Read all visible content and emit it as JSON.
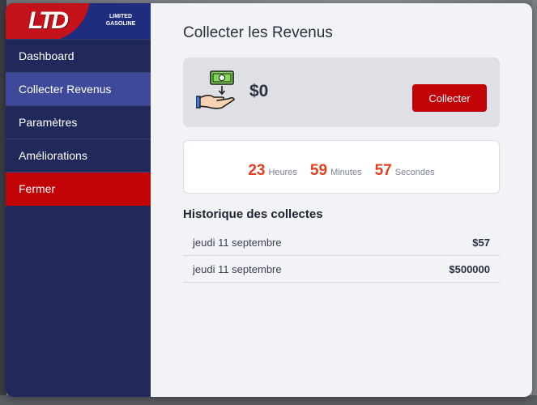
{
  "brand": {
    "logo_text": "LTD",
    "subtitle_line1": "LIMITED",
    "subtitle_line2": "GASOLINE",
    "accent_color": "#c10207",
    "sidebar_color": "#21295a"
  },
  "sidebar": {
    "items": [
      {
        "label": "Dashboard"
      },
      {
        "label": "Collecter Revenus",
        "active": true
      },
      {
        "label": "Paramètres"
      },
      {
        "label": "Améliorations"
      },
      {
        "label": "Fermer"
      }
    ]
  },
  "main": {
    "title": "Collecter les Revenus",
    "revenue": {
      "icon": "money-hand-icon",
      "amount": "$0",
      "button_label": "Collecter"
    },
    "timer": {
      "hours": "23",
      "hours_label": "Heures",
      "minutes": "59",
      "minutes_label": "Minutes",
      "seconds": "57",
      "seconds_label": "Secondes"
    },
    "history": {
      "title": "Historique des collectes",
      "rows": [
        {
          "date": "jeudi 11 septembre",
          "amount": "$57"
        },
        {
          "date": "jeudi 11 septembre",
          "amount": "$500000"
        }
      ]
    }
  }
}
